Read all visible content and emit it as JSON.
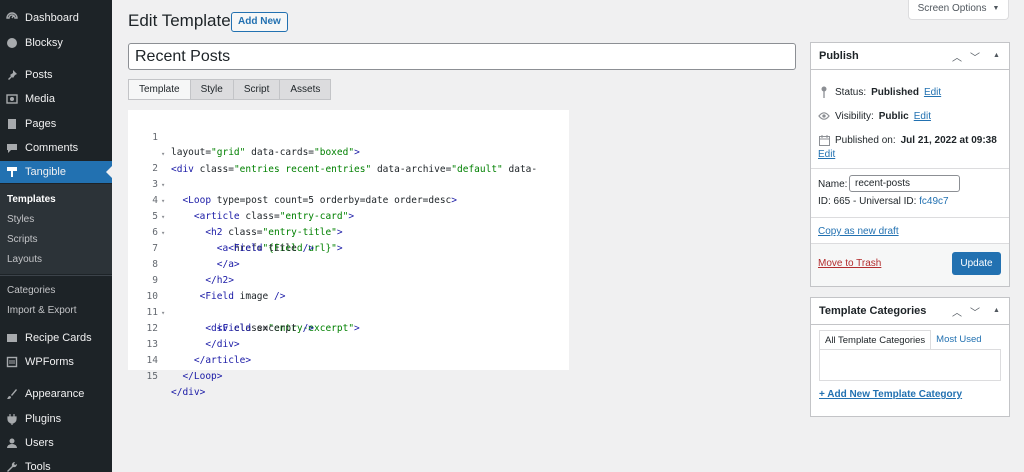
{
  "sidebar": {
    "menu": [
      {
        "label": "Dashboard",
        "icon": "dashboard-icon"
      },
      {
        "label": "Blocksy",
        "icon": "blocksy-icon"
      },
      {
        "label": "Posts",
        "icon": "pin-icon"
      },
      {
        "label": "Media",
        "icon": "media-icon"
      },
      {
        "label": "Pages",
        "icon": "pages-icon"
      },
      {
        "label": "Comments",
        "icon": "comment-icon"
      },
      {
        "label": "Tangible",
        "icon": "tangible-icon"
      },
      {
        "label": "Recipe Cards",
        "icon": "recipe-icon"
      },
      {
        "label": "WPForms",
        "icon": "wpforms-icon"
      },
      {
        "label": "Appearance",
        "icon": "brush-icon"
      },
      {
        "label": "Plugins",
        "icon": "plugin-icon"
      },
      {
        "label": "Users",
        "icon": "user-icon"
      },
      {
        "label": "Tools",
        "icon": "wrench-icon"
      }
    ],
    "submenu": [
      "Templates",
      "Styles",
      "Scripts",
      "Layouts",
      "Categories",
      "Import & Export"
    ]
  },
  "header": {
    "title": "Edit Template",
    "add_new": "Add New",
    "screen_options": "Screen Options"
  },
  "post_title": "Recent Posts",
  "tabs": [
    "Template",
    "Style",
    "Script",
    "Assets"
  ],
  "editor": {
    "line_numbers": [
      "1",
      "2",
      "3",
      "4",
      "5",
      "6",
      "7",
      "8",
      "9",
      "10",
      "11",
      "12",
      "13",
      "14",
      "15"
    ],
    "lines": [
      {
        "t1": "<div ",
        "a1": "class=",
        "s1": "\"entries recent-entries\"",
        "a2": " data-archive=",
        "s2": "\"default\"",
        "a3": " data-",
        "t2": ""
      },
      {
        "t1": "layout=",
        "a1": "",
        "s1": "\"grid\"",
        "a2": " data-cards=",
        "s2": "\"boxed\"",
        "a3": "",
        "t2": ">"
      },
      {
        "t1": "  <Loop ",
        "a1": "type=post count=5 orderby=date order=desc",
        "s1": "",
        "a2": "",
        "s2": "",
        "a3": "",
        "t2": ">"
      },
      {
        "t1": "    <article ",
        "a1": "class=",
        "s1": "\"entry-card\"",
        "a2": "",
        "s2": "",
        "a3": "",
        "t2": ">"
      },
      {
        "t1": "      <h2 ",
        "a1": "class=",
        "s1": "\"entry-title\"",
        "a2": "",
        "s2": "",
        "a3": "",
        "t2": ">"
      },
      {
        "t1": "        <a ",
        "a1": "href=",
        "s1": "\"{Field url}\"",
        "a2": "",
        "s2": "",
        "a3": "",
        "t2": ">"
      },
      {
        "t1": "          <Field ",
        "a1": "title",
        "s1": "",
        "a2": "",
        "s2": "",
        "a3": "",
        "t2": " />"
      },
      {
        "t1": "        </a>",
        "a1": "",
        "s1": "",
        "a2": "",
        "s2": "",
        "a3": "",
        "t2": ""
      },
      {
        "t1": "      </h2>",
        "a1": "",
        "s1": "",
        "a2": "",
        "s2": "",
        "a3": "",
        "t2": ""
      },
      {
        "t1": "     <Field ",
        "a1": "image",
        "s1": "",
        "a2": "",
        "s2": "",
        "a3": "",
        "t2": " />"
      },
      {
        "t1": "      <div ",
        "a1": "class=",
        "s1": "\"entry-excerpt\"",
        "a2": "",
        "s2": "",
        "a3": "",
        "t2": ">"
      },
      {
        "t1": "        <Field ",
        "a1": "excerpt",
        "s1": "",
        "a2": "",
        "s2": "",
        "a3": "",
        "t2": " />"
      },
      {
        "t1": "      </div>",
        "a1": "",
        "s1": "",
        "a2": "",
        "s2": "",
        "a3": "",
        "t2": ""
      },
      {
        "t1": "    </article>",
        "a1": "",
        "s1": "",
        "a2": "",
        "s2": "",
        "a3": "",
        "t2": ""
      },
      {
        "t1": "  </Loop>",
        "a1": "",
        "s1": "",
        "a2": "",
        "s2": "",
        "a3": "",
        "t2": ""
      }
    ],
    "last_line": "</div>"
  },
  "publish": {
    "title": "Publish",
    "status_label": "Status:",
    "status_value": "Published",
    "visibility_label": "Visibility:",
    "visibility_value": "Public",
    "published_label": "Published on:",
    "published_value": "Jul 21, 2022 at 09:38",
    "edit": "Edit",
    "name_label": "Name:",
    "name_value": "recent-posts",
    "id_text": "ID: 665 - Universal ID:",
    "universal_id": "fc49c7",
    "copy_draft": "Copy as new draft",
    "trash": "Move to Trash",
    "update": "Update"
  },
  "categories": {
    "title": "Template Categories",
    "tab_all": "All Template Categories",
    "tab_used": "Most Used",
    "add_new": "+ Add New Template Category"
  },
  "colors": {
    "sidebar_bg": "#1d2327",
    "accent": "#2271b1",
    "trash": "#b32d2e"
  }
}
